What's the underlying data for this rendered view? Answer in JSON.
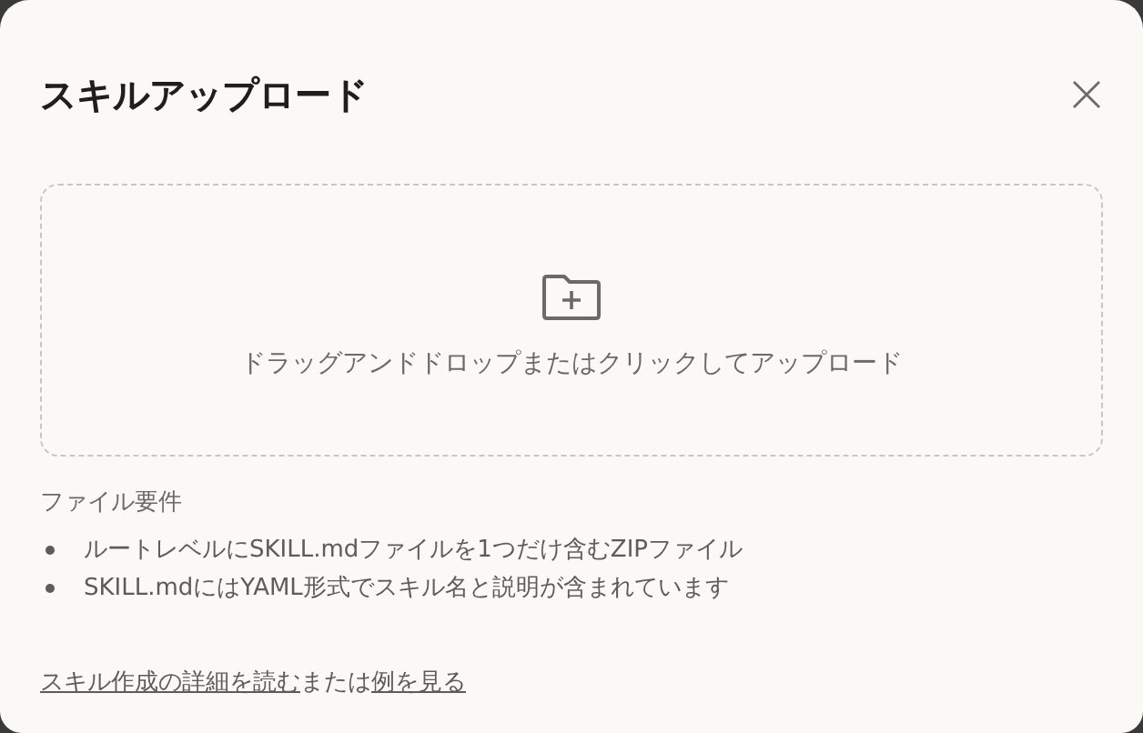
{
  "dialog": {
    "title": "スキルアップロード"
  },
  "dropzone": {
    "text": "ドラッグアンドドロップまたはクリックしてアップロード"
  },
  "requirements": {
    "heading": "ファイル要件",
    "items": [
      "ルートレベルにSKILL.mdファイルを1つだけ含むZIPファイル",
      "SKILL.mdにはYAML形式でスキル名と説明が含まれています"
    ]
  },
  "footer": {
    "link_1": "スキル作成の詳細を読む",
    "middle": "または",
    "link_2": "例を見る"
  }
}
